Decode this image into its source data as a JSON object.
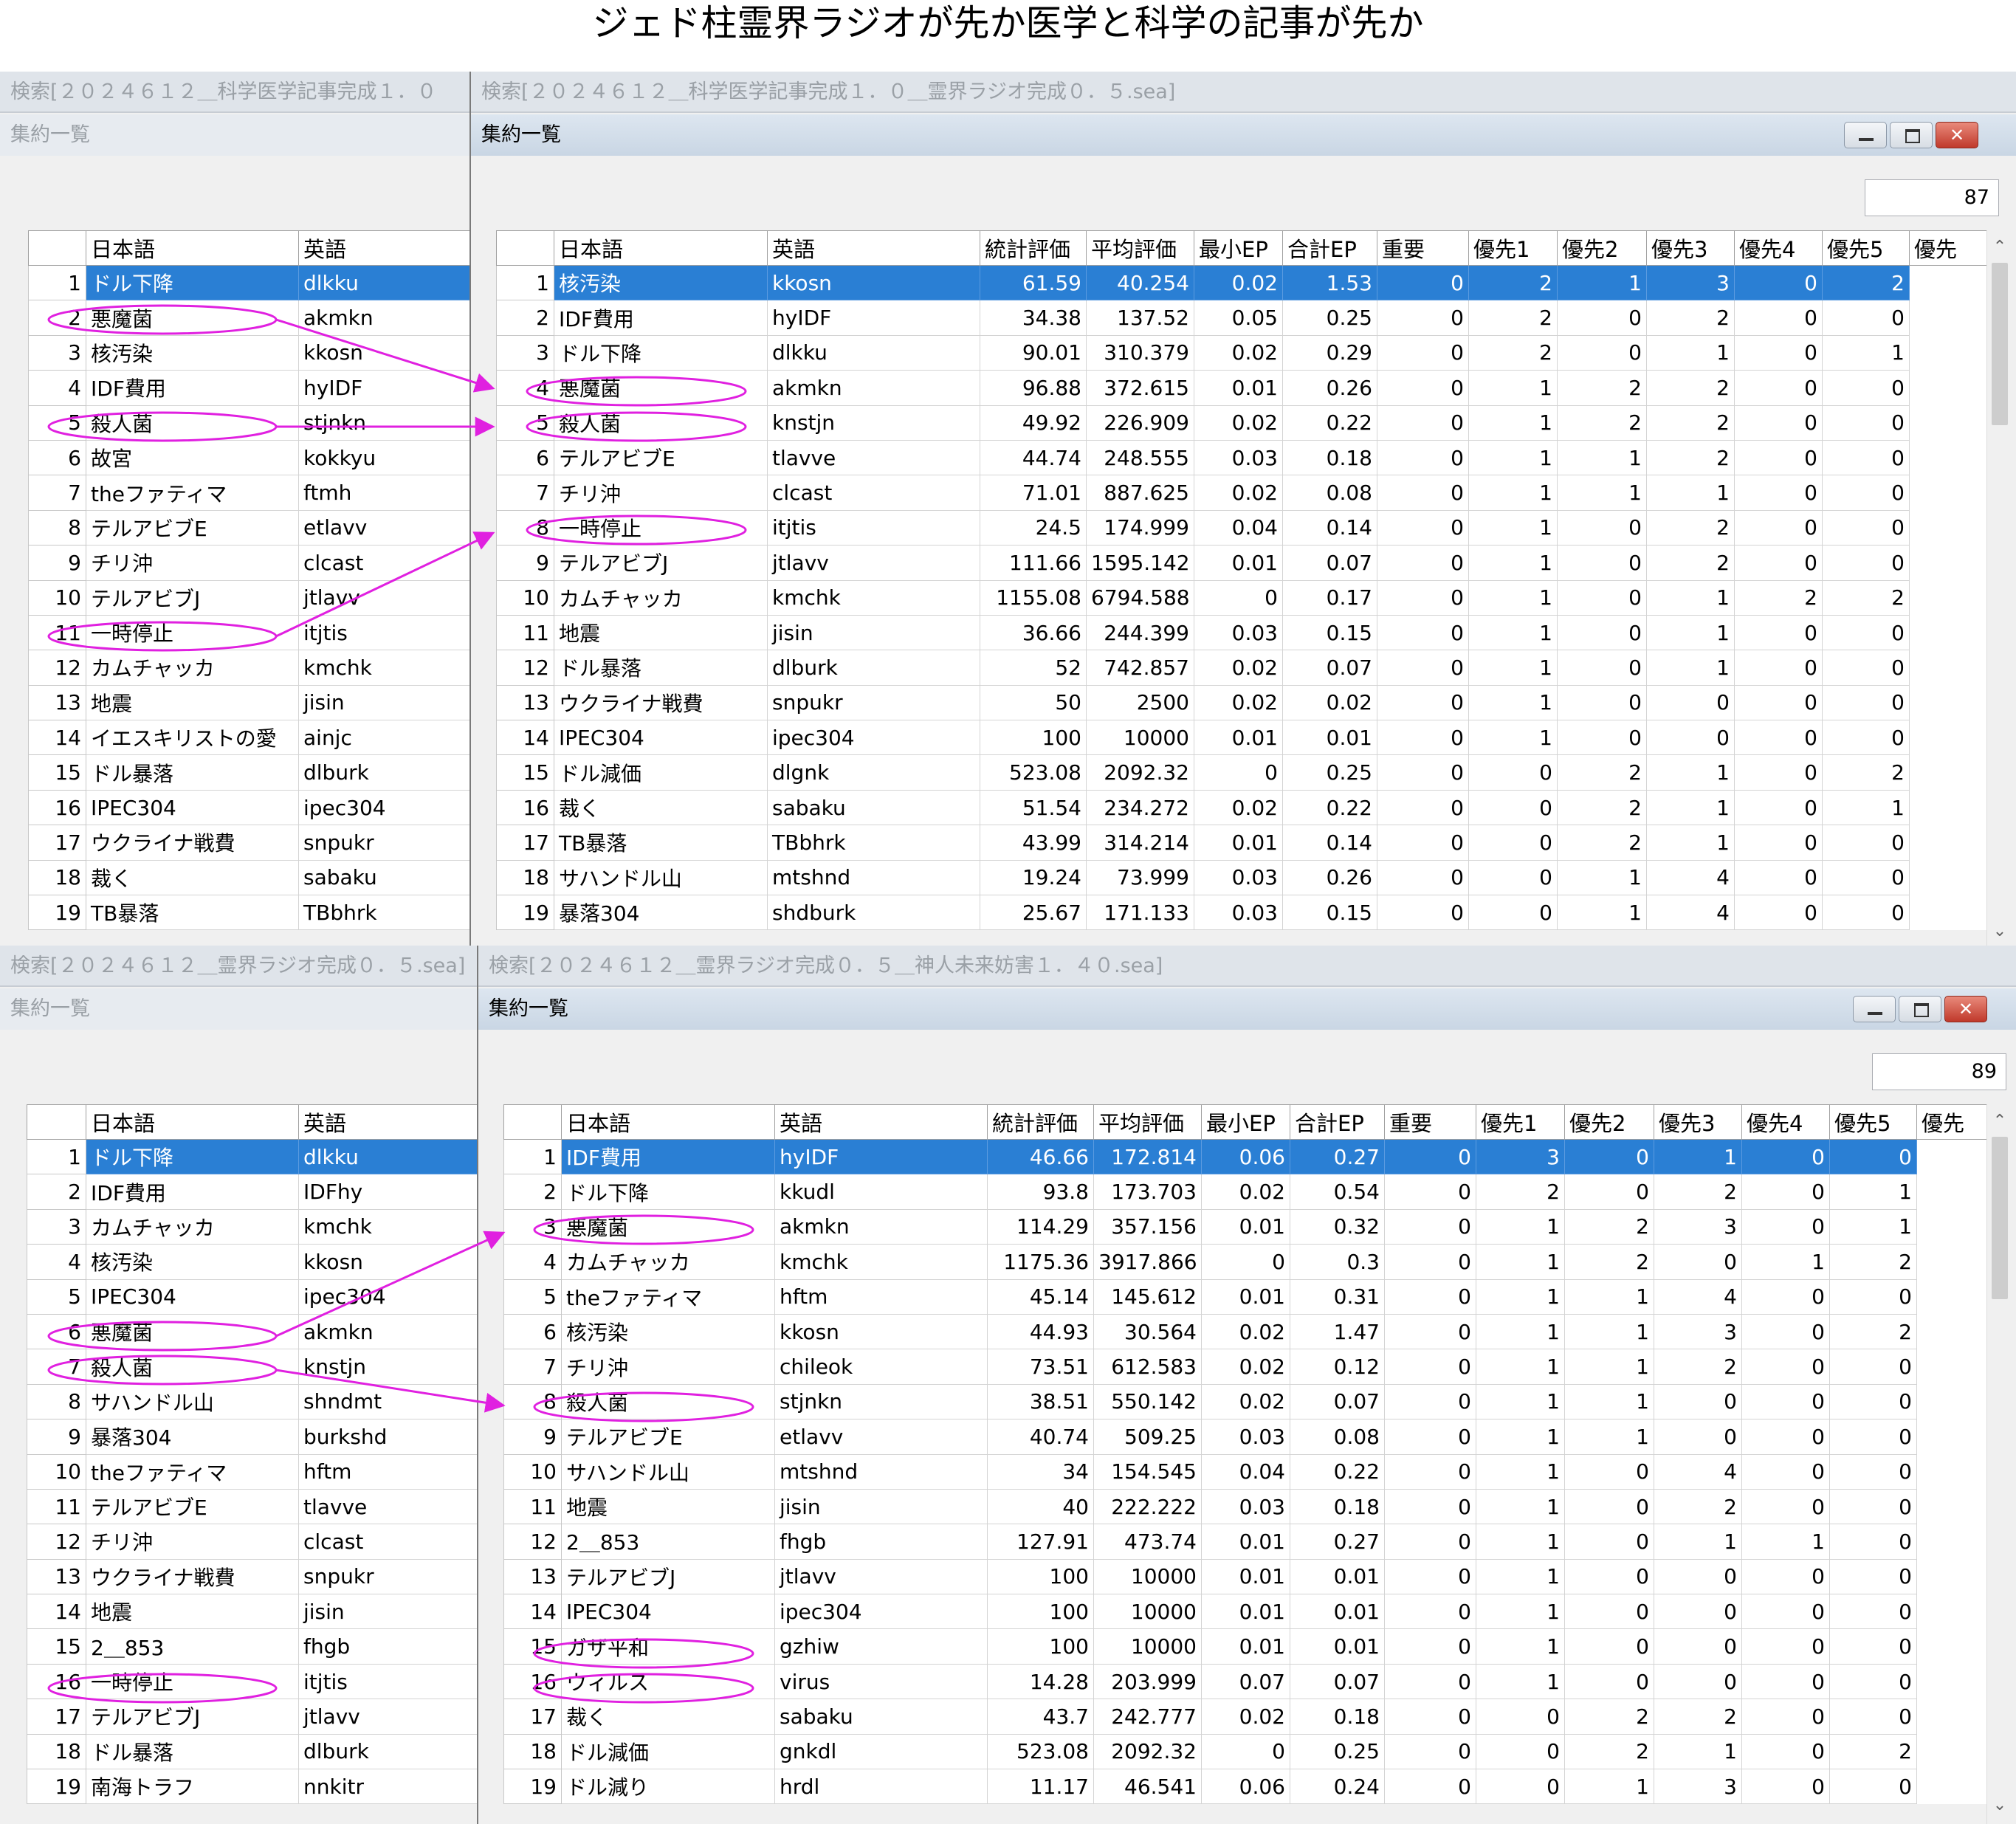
{
  "title": "ジェド柱霊界ラジオが先か医学と科学の記事が先か",
  "colors": {
    "selection": "#2a7fd4",
    "annotation": "#e020e0",
    "close_button": "#c0392b"
  },
  "icons": {
    "minimize": "minimize-icon",
    "maximize": "maximize-icon",
    "close": "close-icon",
    "scroll_up": "chevron-up-icon",
    "scroll_down": "chevron-down-icon"
  },
  "blocks": [
    {
      "left": {
        "caption": "検索[２０２４６１２＿科学医学記事完成１．０",
        "subtitle": "集約一覧",
        "headers": [
          "日本語",
          "英語"
        ],
        "rows": [
          [
            "1",
            "ドル下降",
            "dlkku"
          ],
          [
            "2",
            "悪魔菌",
            "akmkn"
          ],
          [
            "3",
            "核汚染",
            "kkosn"
          ],
          [
            "4",
            "IDF費用",
            "hyIDF"
          ],
          [
            "5",
            "殺人菌",
            "stjnkn"
          ],
          [
            "6",
            "故宮",
            "kokkyu"
          ],
          [
            "7",
            "theファティマ",
            "ftmh"
          ],
          [
            "8",
            "テルアビブE",
            "etlavv"
          ],
          [
            "9",
            "チリ沖",
            "clcast"
          ],
          [
            "10",
            "テルアビブJ",
            "jtlavv"
          ],
          [
            "11",
            "一時停止",
            "itjtis"
          ],
          [
            "12",
            "カムチャッカ",
            "kmchk"
          ],
          [
            "13",
            "地震",
            "jisin"
          ],
          [
            "14",
            "イエスキリストの愛",
            "ainjc"
          ],
          [
            "15",
            "ドル暴落",
            "dlburk"
          ],
          [
            "16",
            "IPEC304",
            "ipec304"
          ],
          [
            "17",
            "ウクライナ戦費",
            "snpukr"
          ],
          [
            "18",
            "裁く",
            "sabaku"
          ],
          [
            "19",
            "TB暴落",
            "TBbhrk"
          ]
        ]
      },
      "right": {
        "caption": "検索[２０２４６１２＿科学医学記事完成１．０＿霊界ラジオ完成０．５.sea]",
        "subtitle": "集約一覧",
        "count": "87",
        "headers": [
          "日本語",
          "英語",
          "統計評価",
          "平均評価",
          "最小EP",
          "合計EP",
          "重要",
          "優先1",
          "優先2",
          "優先3",
          "優先4",
          "優先5",
          "優先"
        ],
        "rows": [
          [
            "1",
            "核汚染",
            "kkosn",
            "61.59",
            "40.254",
            "0.02",
            "1.53",
            "0",
            "2",
            "1",
            "3",
            "0",
            "2"
          ],
          [
            "2",
            "IDF費用",
            "hyIDF",
            "34.38",
            "137.52",
            "0.05",
            "0.25",
            "0",
            "2",
            "0",
            "2",
            "0",
            "0"
          ],
          [
            "3",
            "ドル下降",
            "dlkku",
            "90.01",
            "310.379",
            "0.02",
            "0.29",
            "0",
            "2",
            "0",
            "1",
            "0",
            "1"
          ],
          [
            "4",
            "悪魔菌",
            "akmkn",
            "96.88",
            "372.615",
            "0.01",
            "0.26",
            "0",
            "1",
            "2",
            "2",
            "0",
            "0"
          ],
          [
            "5",
            "殺人菌",
            "knstjn",
            "49.92",
            "226.909",
            "0.02",
            "0.22",
            "0",
            "1",
            "2",
            "2",
            "0",
            "0"
          ],
          [
            "6",
            "テルアビブE",
            "tlavve",
            "44.74",
            "248.555",
            "0.03",
            "0.18",
            "0",
            "1",
            "1",
            "2",
            "0",
            "0"
          ],
          [
            "7",
            "チリ沖",
            "clcast",
            "71.01",
            "887.625",
            "0.02",
            "0.08",
            "0",
            "1",
            "1",
            "1",
            "0",
            "0"
          ],
          [
            "8",
            "一時停止",
            "itjtis",
            "24.5",
            "174.999",
            "0.04",
            "0.14",
            "0",
            "1",
            "0",
            "2",
            "0",
            "0"
          ],
          [
            "9",
            "テルアビブJ",
            "jtlavv",
            "111.66",
            "1595.142",
            "0.01",
            "0.07",
            "0",
            "1",
            "0",
            "2",
            "0",
            "0"
          ],
          [
            "10",
            "カムチャッカ",
            "kmchk",
            "1155.08",
            "6794.588",
            "0",
            "0.17",
            "0",
            "1",
            "0",
            "1",
            "2",
            "2"
          ],
          [
            "11",
            "地震",
            "jisin",
            "36.66",
            "244.399",
            "0.03",
            "0.15",
            "0",
            "1",
            "0",
            "1",
            "0",
            "0"
          ],
          [
            "12",
            "ドル暴落",
            "dlburk",
            "52",
            "742.857",
            "0.02",
            "0.07",
            "0",
            "1",
            "0",
            "1",
            "0",
            "0"
          ],
          [
            "13",
            "ウクライナ戦費",
            "snpukr",
            "50",
            "2500",
            "0.02",
            "0.02",
            "0",
            "1",
            "0",
            "0",
            "0",
            "0"
          ],
          [
            "14",
            "IPEC304",
            "ipec304",
            "100",
            "10000",
            "0.01",
            "0.01",
            "0",
            "1",
            "0",
            "0",
            "0",
            "0"
          ],
          [
            "15",
            "ドル減価",
            "dlgnk",
            "523.08",
            "2092.32",
            "0",
            "0.25",
            "0",
            "0",
            "2",
            "1",
            "0",
            "2"
          ],
          [
            "16",
            "裁く",
            "sabaku",
            "51.54",
            "234.272",
            "0.02",
            "0.22",
            "0",
            "0",
            "2",
            "1",
            "0",
            "1"
          ],
          [
            "17",
            "TB暴落",
            "TBbhrk",
            "43.99",
            "314.214",
            "0.01",
            "0.14",
            "0",
            "0",
            "2",
            "1",
            "0",
            "0"
          ],
          [
            "18",
            "サハンドル山",
            "mtshnd",
            "19.24",
            "73.999",
            "0.03",
            "0.26",
            "0",
            "0",
            "1",
            "4",
            "0",
            "0"
          ],
          [
            "19",
            "暴落304",
            "shdburk",
            "25.67",
            "171.133",
            "0.03",
            "0.15",
            "0",
            "0",
            "1",
            "4",
            "0",
            "0"
          ]
        ]
      }
    },
    {
      "left": {
        "caption": "検索[２０２４６１２＿霊界ラジオ完成０．５.sea]",
        "subtitle": "集約一覧",
        "headers": [
          "日本語",
          "英語"
        ],
        "rows": [
          [
            "1",
            "ドル下降",
            "dlkku"
          ],
          [
            "2",
            "IDF費用",
            "IDFhy"
          ],
          [
            "3",
            "カムチャッカ",
            "kmchk"
          ],
          [
            "4",
            "核汚染",
            "kkosn"
          ],
          [
            "5",
            "IPEC304",
            "ipec304"
          ],
          [
            "6",
            "悪魔菌",
            "akmkn"
          ],
          [
            "7",
            "殺人菌",
            "knstjn"
          ],
          [
            "8",
            "サハンドル山",
            "shndmt"
          ],
          [
            "9",
            "暴落304",
            "burkshd"
          ],
          [
            "10",
            "theファティマ",
            "hftm"
          ],
          [
            "11",
            "テルアビブE",
            "tlavve"
          ],
          [
            "12",
            "チリ沖",
            "clcast"
          ],
          [
            "13",
            "ウクライナ戦費",
            "snpukr"
          ],
          [
            "14",
            "地震",
            "jisin"
          ],
          [
            "15",
            "2＿853",
            "fhgb"
          ],
          [
            "16",
            "一時停止",
            "itjtis"
          ],
          [
            "17",
            "テルアビブJ",
            "jtlavv"
          ],
          [
            "18",
            "ドル暴落",
            "dlburk"
          ],
          [
            "19",
            "南海トラフ",
            "nnkitr"
          ]
        ]
      },
      "right": {
        "caption": "検索[２０２４６１２＿霊界ラジオ完成０．５＿神人未来妨害１．４０.sea]",
        "subtitle": "集約一覧",
        "count": "89",
        "headers": [
          "日本語",
          "英語",
          "統計評価",
          "平均評価",
          "最小EP",
          "合計EP",
          "重要",
          "優先1",
          "優先2",
          "優先3",
          "優先4",
          "優先5",
          "優先"
        ],
        "rows": [
          [
            "1",
            "IDF費用",
            "hyIDF",
            "46.66",
            "172.814",
            "0.06",
            "0.27",
            "0",
            "3",
            "0",
            "1",
            "0",
            "0"
          ],
          [
            "2",
            "ドル下降",
            "kkudl",
            "93.8",
            "173.703",
            "0.02",
            "0.54",
            "0",
            "2",
            "0",
            "2",
            "0",
            "1"
          ],
          [
            "3",
            "悪魔菌",
            "akmkn",
            "114.29",
            "357.156",
            "0.01",
            "0.32",
            "0",
            "1",
            "2",
            "3",
            "0",
            "1"
          ],
          [
            "4",
            "カムチャッカ",
            "kmchk",
            "1175.36",
            "3917.866",
            "0",
            "0.3",
            "0",
            "1",
            "2",
            "0",
            "1",
            "2"
          ],
          [
            "5",
            "theファティマ",
            "hftm",
            "45.14",
            "145.612",
            "0.01",
            "0.31",
            "0",
            "1",
            "1",
            "4",
            "0",
            "0"
          ],
          [
            "6",
            "核汚染",
            "kkosn",
            "44.93",
            "30.564",
            "0.02",
            "1.47",
            "0",
            "1",
            "1",
            "3",
            "0",
            "2"
          ],
          [
            "7",
            "チリ沖",
            "chileok",
            "73.51",
            "612.583",
            "0.02",
            "0.12",
            "0",
            "1",
            "1",
            "2",
            "0",
            "0"
          ],
          [
            "8",
            "殺人菌",
            "stjnkn",
            "38.51",
            "550.142",
            "0.02",
            "0.07",
            "0",
            "1",
            "1",
            "0",
            "0",
            "0"
          ],
          [
            "9",
            "テルアビブE",
            "etlavv",
            "40.74",
            "509.25",
            "0.03",
            "0.08",
            "0",
            "1",
            "1",
            "0",
            "0",
            "0"
          ],
          [
            "10",
            "サハンドル山",
            "mtshnd",
            "34",
            "154.545",
            "0.04",
            "0.22",
            "0",
            "1",
            "0",
            "4",
            "0",
            "0"
          ],
          [
            "11",
            "地震",
            "jisin",
            "40",
            "222.222",
            "0.03",
            "0.18",
            "0",
            "1",
            "0",
            "2",
            "0",
            "0"
          ],
          [
            "12",
            "2＿853",
            "fhgb",
            "127.91",
            "473.74",
            "0.01",
            "0.27",
            "0",
            "1",
            "0",
            "1",
            "1",
            "0"
          ],
          [
            "13",
            "テルアビブJ",
            "jtlavv",
            "100",
            "10000",
            "0.01",
            "0.01",
            "0",
            "1",
            "0",
            "0",
            "0",
            "0"
          ],
          [
            "14",
            "IPEC304",
            "ipec304",
            "100",
            "10000",
            "0.01",
            "0.01",
            "0",
            "1",
            "0",
            "0",
            "0",
            "0"
          ],
          [
            "15",
            "ガザ平和",
            "gzhiw",
            "100",
            "10000",
            "0.01",
            "0.01",
            "0",
            "1",
            "0",
            "0",
            "0",
            "0"
          ],
          [
            "16",
            "ウィルス",
            "virus",
            "14.28",
            "203.999",
            "0.07",
            "0.07",
            "0",
            "1",
            "0",
            "0",
            "0",
            "0"
          ],
          [
            "17",
            "裁く",
            "sabaku",
            "43.7",
            "242.777",
            "0.02",
            "0.18",
            "0",
            "0",
            "2",
            "2",
            "0",
            "0"
          ],
          [
            "18",
            "ドル減価",
            "gnkdl",
            "523.08",
            "2092.32",
            "0",
            "0.25",
            "0",
            "0",
            "2",
            "1",
            "0",
            "2"
          ],
          [
            "19",
            "ドル減り",
            "hrdl",
            "11.17",
            "46.541",
            "0.06",
            "0.24",
            "0",
            "0",
            "1",
            "3",
            "0",
            "0"
          ]
        ]
      }
    }
  ]
}
